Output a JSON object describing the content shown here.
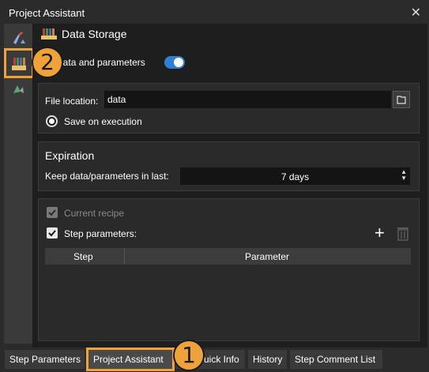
{
  "window": {
    "title": "Project Assistant",
    "close_icon": "close-icon"
  },
  "sidebar": {
    "items": [
      {
        "icon": "flask-icon"
      },
      {
        "icon": "database-icon",
        "highlighted": true
      },
      {
        "icon": "triangle-chart-icon"
      }
    ]
  },
  "header": {
    "title": "Data Storage",
    "icon": "database-icon"
  },
  "storage": {
    "label": "e data and parameters",
    "enabled": true
  },
  "file": {
    "location_label": "File location:",
    "location_value": "data",
    "save_on_execution_label": "Save on execution"
  },
  "expiration": {
    "title": "Expiration",
    "keep_label": "Keep data/parameters in last:",
    "keep_value": "7 days"
  },
  "recipe": {
    "current_recipe_label": "Current recipe",
    "step_parameters_label": "Step parameters:",
    "table": {
      "columns": [
        "Step",
        "Parameter"
      ]
    }
  },
  "tabs": [
    "Step Parameters",
    "Project Assistant",
    "uick Info",
    "History",
    "Step Comment List"
  ],
  "callouts": [
    "1",
    "2"
  ],
  "colors": {
    "accent": "#2f7fd6",
    "highlight": "#f0a23a"
  }
}
